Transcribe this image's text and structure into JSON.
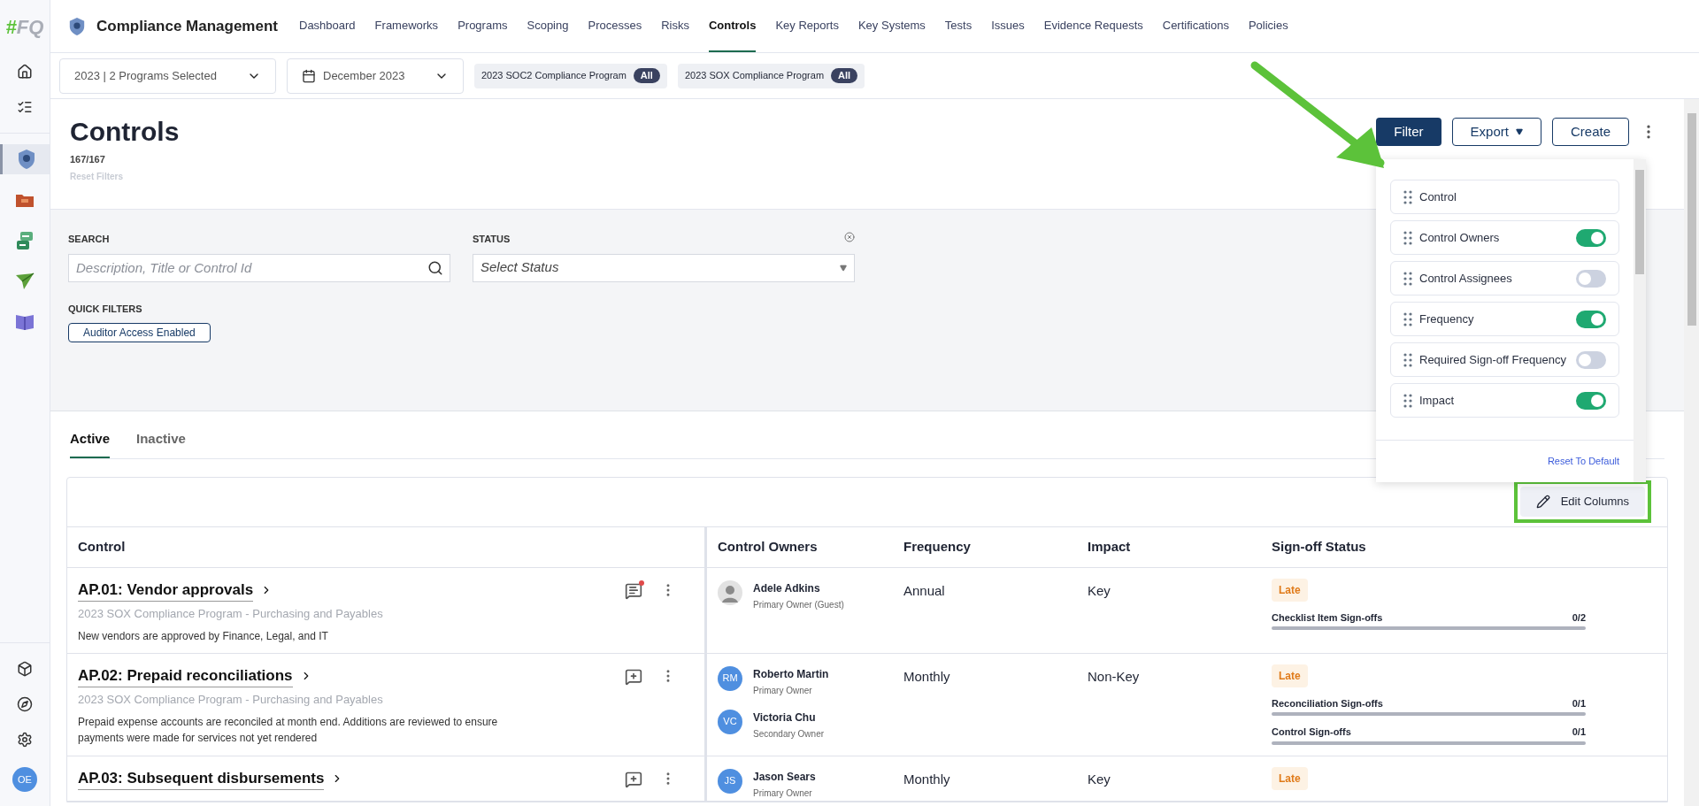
{
  "logo": {
    "mark": "#",
    "text": "FQ"
  },
  "sidebar": {
    "apps": [
      {
        "kind": "shield",
        "selected": true
      },
      {
        "kind": "folder",
        "selected": false
      },
      {
        "kind": "arrows",
        "selected": false
      },
      {
        "kind": "plane",
        "selected": false
      },
      {
        "kind": "book",
        "selected": false
      }
    ],
    "avatar": "OE"
  },
  "nav": {
    "title": "Compliance Management",
    "items": [
      {
        "label": "Dashboard",
        "selected": false
      },
      {
        "label": "Frameworks",
        "selected": false
      },
      {
        "label": "Programs",
        "selected": false
      },
      {
        "label": "Scoping",
        "selected": false
      },
      {
        "label": "Processes",
        "selected": false
      },
      {
        "label": "Risks",
        "selected": false
      },
      {
        "label": "Controls",
        "selected": true
      },
      {
        "label": "Key Reports",
        "selected": false
      },
      {
        "label": "Key Systems",
        "selected": false
      },
      {
        "label": "Tests",
        "selected": false
      },
      {
        "label": "Issues",
        "selected": false
      },
      {
        "label": "Evidence Requests",
        "selected": false
      },
      {
        "label": "Certifications",
        "selected": false
      },
      {
        "label": "Policies",
        "selected": false
      }
    ]
  },
  "context_bar": {
    "program_select": "2023 | 2 Programs Selected",
    "date_select": "December 2023",
    "programs": [
      {
        "label": "2023 SOC2 Compliance Program",
        "badge": "All"
      },
      {
        "label": "2023 SOX Compliance Program",
        "badge": "All"
      }
    ]
  },
  "header": {
    "title": "Controls",
    "count": "167/167",
    "reset": "Reset Filters",
    "buttons": [
      "Filter",
      "Export",
      "Create"
    ]
  },
  "filters": {
    "search_label": "SEARCH",
    "search_placeholder": "Description, Title or Control Id",
    "status_label": "STATUS",
    "status_placeholder": "Select Status",
    "quick_label": "QUICK FILTERS",
    "quick_chips": [
      "Auditor Access Enabled"
    ]
  },
  "tabs": [
    {
      "label": "Active",
      "selected": true
    },
    {
      "label": "Inactive",
      "selected": false
    }
  ],
  "column_menu": {
    "items": [
      {
        "label": "Control",
        "kind": "fixed"
      },
      {
        "label": "Control Owners",
        "kind": "toggle",
        "on": true
      },
      {
        "label": "Control Assignees",
        "kind": "toggle",
        "on": false
      },
      {
        "label": "Frequency",
        "kind": "toggle",
        "on": true
      },
      {
        "label": "Required Sign-off Frequency",
        "kind": "toggle",
        "on": false
      },
      {
        "label": "Impact",
        "kind": "toggle",
        "on": true
      }
    ],
    "reset": "Reset To Default"
  },
  "edit_columns": "Edit Columns",
  "table": {
    "columns": [
      "Control",
      "Control Owners",
      "Frequency",
      "Impact",
      "Sign-off Status"
    ],
    "rows": [
      {
        "title": "AP.01: Vendor approvals",
        "program": "2023 SOX Compliance Program - Purchasing and Payables",
        "description": "New vendors are approved by Finance, Legal, and IT",
        "has_comments": true,
        "owners": [
          {
            "kind": "silhouette",
            "name": "Adele Adkins",
            "role": "Primary Owner (Guest)"
          }
        ],
        "frequency": "Annual",
        "impact": "Key",
        "status": "Late",
        "signoffs": [
          {
            "label": "Checklist Item Sign-offs",
            "count": "0/2",
            "level": 0
          }
        ]
      },
      {
        "title": "AP.02: Prepaid reconciliations",
        "program": "2023 SOX Compliance Program - Purchasing and Payables",
        "description": "Prepaid expense accounts are reconciled at month end. Additions are reviewed to ensure payments were made for services not yet rendered",
        "has_comments": false,
        "owners": [
          {
            "kind": "initials",
            "initials": "RM",
            "name": "Roberto Martin",
            "role": "Primary Owner"
          },
          {
            "kind": "initials",
            "initials": "VC",
            "name": "Victoria Chu",
            "role": "Secondary Owner"
          }
        ],
        "frequency": "Monthly",
        "impact": "Non-Key",
        "status": "Late",
        "signoffs": [
          {
            "label": "Reconciliation Sign-offs",
            "count": "0/1",
            "level": 0
          },
          {
            "label": "Control Sign-offs",
            "count": "0/1",
            "level": 0
          }
        ]
      },
      {
        "title": "AP.03: Subsequent disbursements",
        "has_comments": false,
        "owners": [
          {
            "kind": "initials",
            "initials": "JS",
            "name": "Jason Sears",
            "role": "Primary Owner"
          }
        ],
        "frequency": "Monthly",
        "impact": "Key",
        "status": "Late",
        "signoffs": []
      }
    ]
  }
}
